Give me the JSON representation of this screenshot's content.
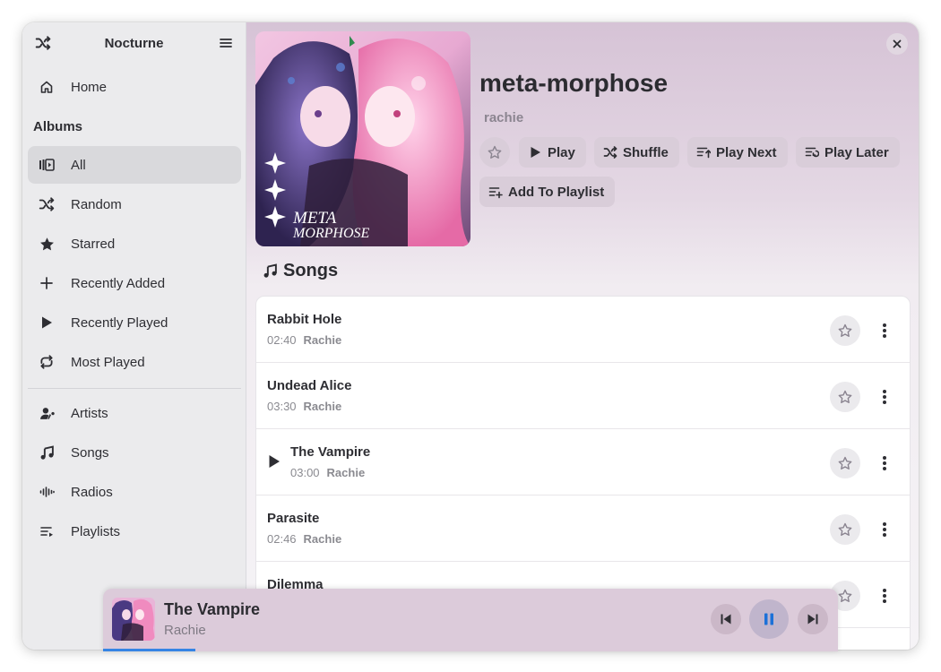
{
  "app": {
    "title": "Nocturne"
  },
  "sidebar": {
    "home_label": "Home",
    "section_label": "Albums",
    "album_items": [
      {
        "label": "All",
        "icon": "library-icon",
        "active": true
      },
      {
        "label": "Random",
        "icon": "shuffle-icon"
      },
      {
        "label": "Starred",
        "icon": "star-icon"
      },
      {
        "label": "Recently Added",
        "icon": "plus-icon"
      },
      {
        "label": "Recently Played",
        "icon": "play-icon"
      },
      {
        "label": "Most Played",
        "icon": "repeat-icon"
      }
    ],
    "other_items": [
      {
        "label": "Artists",
        "icon": "artist-icon"
      },
      {
        "label": "Songs",
        "icon": "music-note-icon"
      },
      {
        "label": "Radios",
        "icon": "radio-wave-icon"
      },
      {
        "label": "Playlists",
        "icon": "playlist-icon"
      }
    ]
  },
  "album": {
    "title": "meta-morphose",
    "artist": "rachie",
    "cover_text_line1": "META",
    "cover_text_line2": "MORPHOSE",
    "actions": {
      "play": "Play",
      "shuffle": "Shuffle",
      "play_next": "Play Next",
      "play_later": "Play Later",
      "add_to_playlist": "Add To Playlist"
    }
  },
  "songs_section": {
    "heading": "Songs",
    "rows": [
      {
        "title": "Rabbit Hole",
        "duration": "02:40",
        "artist": "Rachie",
        "playing": false
      },
      {
        "title": "Undead Alice",
        "duration": "03:30",
        "artist": "Rachie",
        "playing": false
      },
      {
        "title": "The Vampire",
        "duration": "03:00",
        "artist": "Rachie",
        "playing": true
      },
      {
        "title": "Parasite",
        "duration": "02:46",
        "artist": "Rachie",
        "playing": false
      },
      {
        "title": "Dilemma",
        "duration": "",
        "artist": "",
        "playing": false
      }
    ]
  },
  "player": {
    "title": "The Vampire",
    "artist": "Rachie",
    "progress": 0.125
  },
  "colors": {
    "accent": "#3584e4",
    "header_tint": "#d6c3d6",
    "player_bg": "#dccbda"
  }
}
